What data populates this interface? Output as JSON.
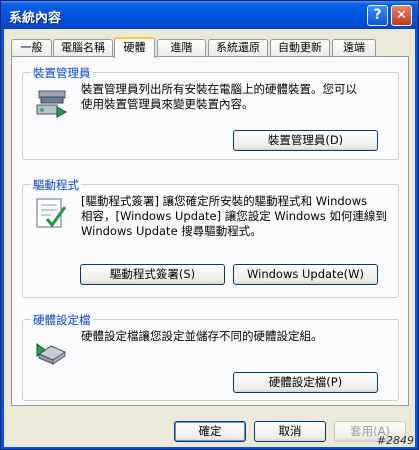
{
  "window": {
    "title": "系統內容"
  },
  "tabs": [
    {
      "label": "一般"
    },
    {
      "label": "電腦名稱"
    },
    {
      "label": "硬體"
    },
    {
      "label": "進階"
    },
    {
      "label": "系統還原"
    },
    {
      "label": "自動更新"
    },
    {
      "label": "遠端"
    }
  ],
  "device_manager": {
    "title": "裝置管理員",
    "line1": "裝置管理員列出所有安裝在電腦上的硬體裝置。您可以",
    "line2": "使用裝置管理員來變更裝置內容。",
    "button": "裝置管理員(D)",
    "icon": "device-manager-icon"
  },
  "drivers": {
    "title": "驅動程式",
    "line1": "[驅動程式簽署] 讓您確定所安裝的驅動程式和 Windows",
    "line2": "相容，[Windows Update] 讓您設定 Windows 如何連線到",
    "line3": "Windows Update 搜尋驅動程式。",
    "signing_button": "驅動程式簽署(S)",
    "update_button": "Windows Update(W)",
    "icon": "driver-signing-icon"
  },
  "hardware_profiles": {
    "title": "硬體設定檔",
    "line1": "硬體設定檔讓您設定並儲存不同的硬體設定組。",
    "button": "硬體設定檔(P)",
    "icon": "hardware-profile-icon"
  },
  "footer": {
    "ok": "確定",
    "cancel": "取消",
    "apply": "套用(A)"
  },
  "watermark": "#2849"
}
